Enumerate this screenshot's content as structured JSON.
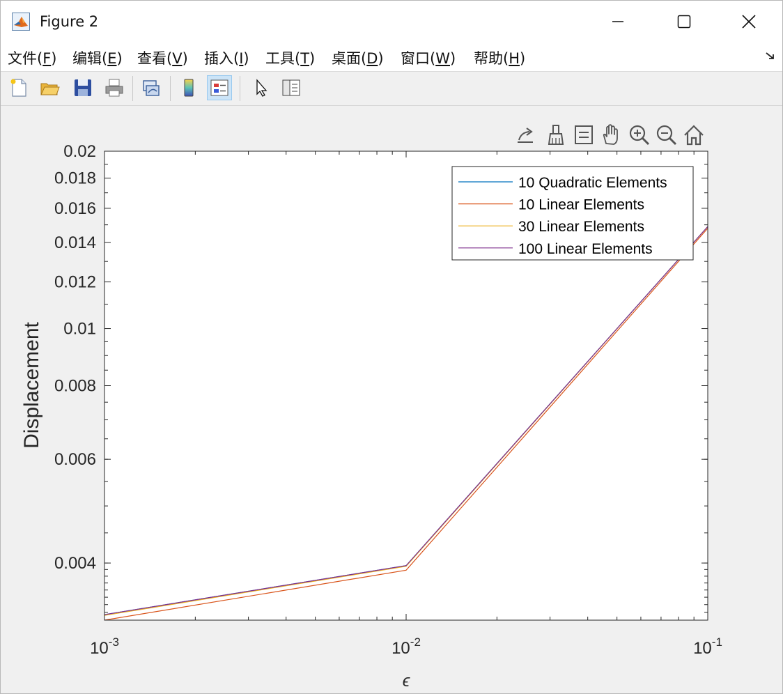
{
  "window": {
    "title": "Figure 2"
  },
  "menu": [
    {
      "label": "文件(F)"
    },
    {
      "label": "编辑(E)"
    },
    {
      "label": "查看(V)"
    },
    {
      "label": "插入(I)"
    },
    {
      "label": "工具(T)"
    },
    {
      "label": "桌面(D)"
    },
    {
      "label": "窗口(W)"
    },
    {
      "label": "帮助(H)"
    }
  ],
  "toolbar": {
    "icons": [
      "new-figure-icon",
      "open-file-icon",
      "save-icon",
      "print-icon",
      "link-plot-icon",
      "colorbar-icon",
      "legend-icon",
      "edit-plot-icon",
      "property-inspector-icon"
    ]
  },
  "axes_toolbar": {
    "icons": [
      "export-icon",
      "brush-icon",
      "data-tips-icon",
      "pan-icon",
      "zoom-in-icon",
      "zoom-out-icon",
      "home-icon"
    ]
  },
  "chart_data": {
    "type": "line",
    "xlabel": "ϵ",
    "ylabel": "Displacement",
    "xscale": "log",
    "yscale": "log",
    "xlim": [
      0.001,
      0.1
    ],
    "ylim": [
      0.0032,
      0.02
    ],
    "xticks": [
      0.001,
      0.01,
      0.1
    ],
    "xtick_base": "10",
    "xtick_exponents": [
      "-3",
      "-2",
      "-1"
    ],
    "yticks": [
      0.004,
      0.006,
      0.008,
      0.01,
      0.012,
      0.014,
      0.016,
      0.018,
      0.02
    ],
    "ytick_labels": [
      "0.004",
      "0.006",
      "0.008",
      "0.01",
      "0.012",
      "0.014",
      "0.016",
      "0.018",
      "0.02"
    ],
    "grid": false,
    "legend_position": "top-right",
    "x": [
      0.001,
      0.01,
      0.1
    ],
    "series": [
      {
        "name": "10 Quadratic Elements",
        "color": "#0072BD",
        "values": [
          0.00327,
          0.00396,
          0.0149
        ]
      },
      {
        "name": "10 Linear Elements",
        "color": "#D95319",
        "values": [
          0.0032,
          0.00389,
          0.0148
        ]
      },
      {
        "name": "30 Linear Elements",
        "color": "#EDB120",
        "values": [
          0.00326,
          0.00395,
          0.0149
        ]
      },
      {
        "name": "100 Linear Elements",
        "color": "#7E2F8E",
        "values": [
          0.00327,
          0.00396,
          0.0149
        ]
      }
    ]
  }
}
